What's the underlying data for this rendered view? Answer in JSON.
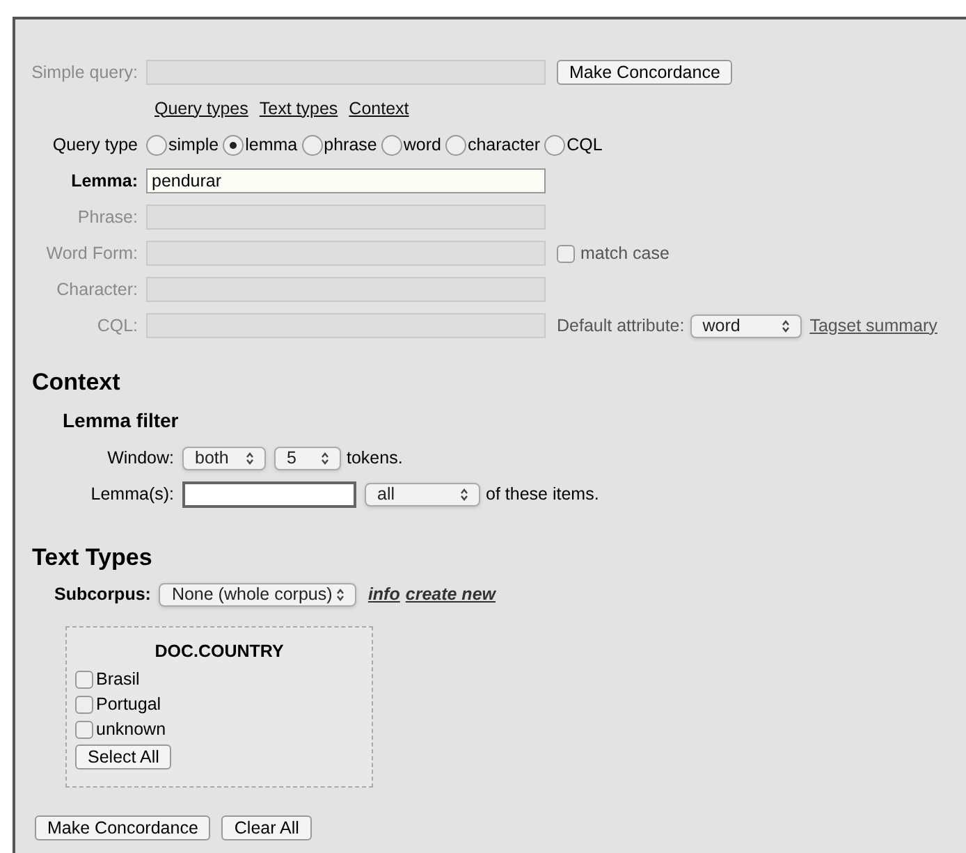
{
  "simple_query": {
    "label": "Simple query:",
    "disabled": true,
    "button": "Make Concordance"
  },
  "links": [
    "Query types",
    "Text types",
    "Context"
  ],
  "query_type": {
    "label": "Query type",
    "options": [
      {
        "label": "simple",
        "selected": false
      },
      {
        "label": "lemma",
        "selected": true
      },
      {
        "label": "phrase",
        "selected": false
      },
      {
        "label": "word",
        "selected": false
      },
      {
        "label": "character",
        "selected": false
      },
      {
        "label": "CQL",
        "selected": false
      }
    ]
  },
  "fields": [
    {
      "kind": "plain",
      "label": "Lemma:",
      "value": "pendurar",
      "disabled": false
    },
    {
      "kind": "plain",
      "label": "Phrase:",
      "disabled": true
    },
    {
      "kind": "match_case",
      "label": "Word Form:",
      "disabled": true,
      "checkbox": {
        "label": "match case",
        "checked": false
      }
    },
    {
      "kind": "plain",
      "label": "Character:",
      "disabled": true
    },
    {
      "kind": "cql",
      "label": "CQL:",
      "disabled": true,
      "attribute_label": "Default attribute:",
      "attribute": "word",
      "link": "Tagset summary"
    }
  ],
  "context": {
    "heading": "Context",
    "subheading": "Lemma filter",
    "window": {
      "label": "Window:",
      "side": "both",
      "size": "5",
      "suffix": "tokens."
    },
    "lemmas": {
      "label": "Lemma(s):",
      "match": "all",
      "suffix": "of these items."
    }
  },
  "text_types": {
    "heading": "Text Types",
    "subcorpus_label": "Subcorpus:",
    "subcorpus": "None (whole corpus)",
    "links": [
      "info",
      "create new"
    ],
    "attribute": {
      "title": "DOC.COUNTRY",
      "values": [
        {
          "label": "Brasil",
          "checked": false
        },
        {
          "label": "Portugal",
          "checked": false
        },
        {
          "label": "unknown",
          "checked": false
        }
      ],
      "button": "Select All"
    }
  },
  "buttons": [
    "Make Concordance",
    "Clear All"
  ]
}
